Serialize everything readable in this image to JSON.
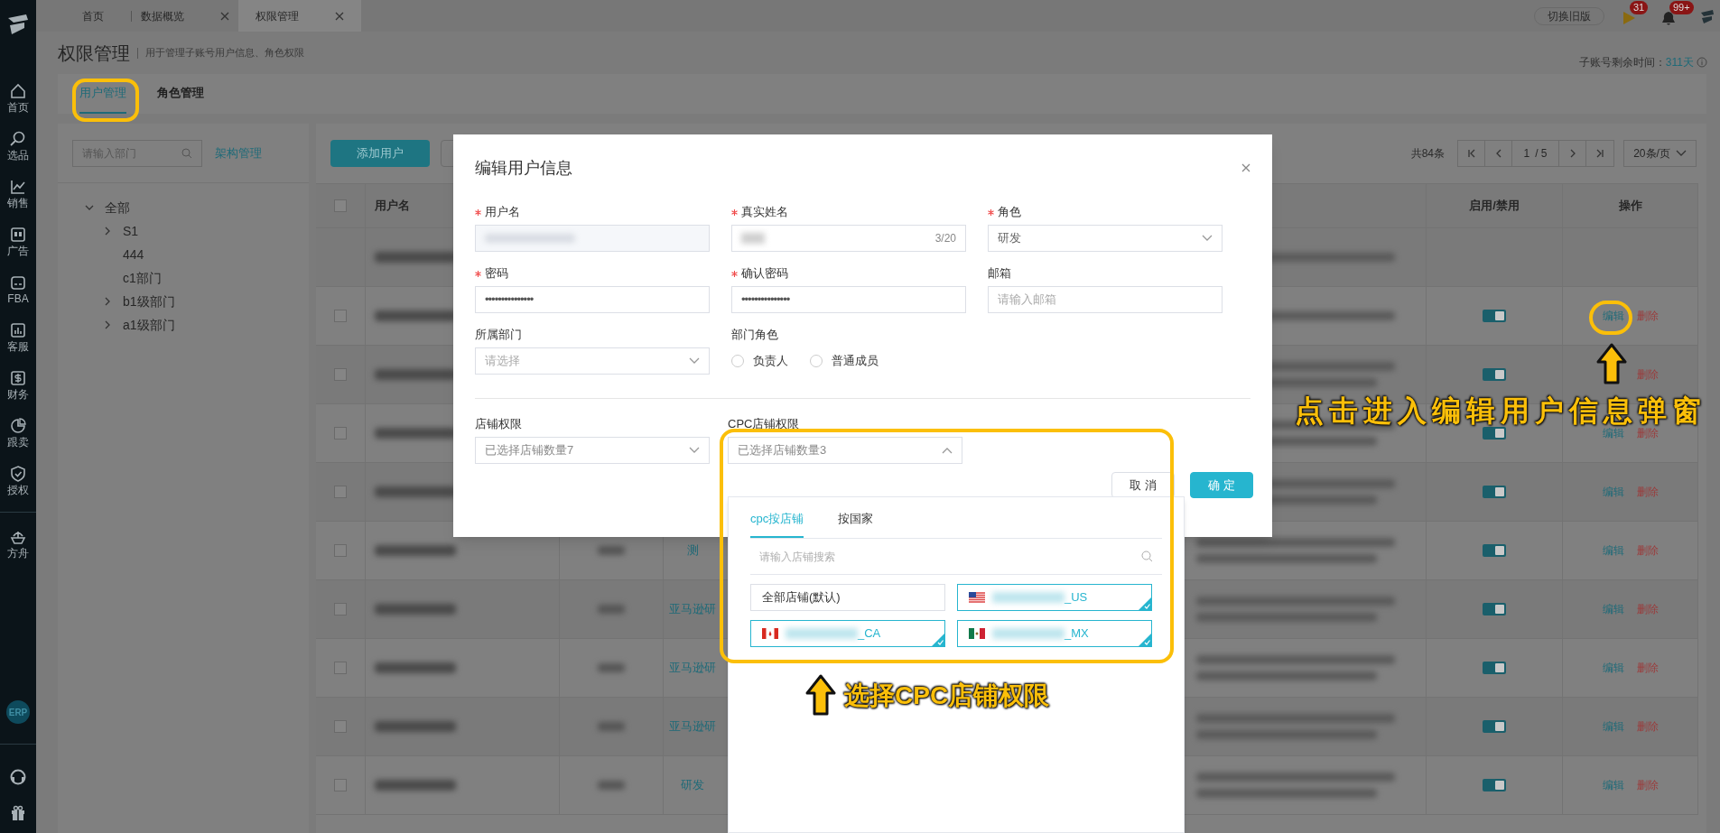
{
  "top_tabs": [
    {
      "label": "首页",
      "selected": false,
      "closable": false
    },
    {
      "label": "数据概览",
      "selected": false,
      "closable": true
    },
    {
      "label": "权限管理",
      "selected": true,
      "closable": true
    }
  ],
  "header": {
    "switch_button": "切换旧版",
    "flag_badge": "31",
    "bell_badge": "99+"
  },
  "sidebar": {
    "items": [
      {
        "label": "首页"
      },
      {
        "label": "选品"
      },
      {
        "label": "销售"
      },
      {
        "label": "广告"
      },
      {
        "label": "FBA"
      },
      {
        "label": "客服"
      },
      {
        "label": "财务"
      },
      {
        "label": "跟卖"
      },
      {
        "label": "授权"
      },
      {
        "label": "方舟"
      }
    ],
    "erp_badge": "ERP"
  },
  "page": {
    "title": "权限管理",
    "subtitle": "用于管理子账号用户信息、角色权限",
    "remaining_label": "子账号剩余时间：",
    "remaining_value": "311天"
  },
  "tabs": [
    {
      "label": "用户管理",
      "selected": true
    },
    {
      "label": "角色管理",
      "selected": false
    }
  ],
  "department_panel": {
    "search_placeholder": "请输入部门",
    "manage_link": "架构管理",
    "tree": [
      {
        "label": "全部",
        "expanded": true,
        "children": [
          {
            "label": "S1",
            "expanded": false,
            "kind": "folder"
          },
          {
            "label": "444",
            "kind": "leaf"
          },
          {
            "label": "c1部门",
            "kind": "leaf"
          },
          {
            "label": "b1级部门",
            "expanded": false,
            "kind": "folder"
          },
          {
            "label": "a1级部门",
            "expanded": false,
            "kind": "folder"
          }
        ]
      }
    ]
  },
  "toolbar": {
    "add_button": "添加用户"
  },
  "pagination": {
    "total": "共84条",
    "page": "1",
    "pages": "/ 5",
    "page_size": "20条/页"
  },
  "table": {
    "all_checked": false,
    "columns": [
      {
        "label": "用户名"
      },
      {
        "label": "启用/禁用"
      },
      {
        "label": "操作"
      }
    ],
    "rows": [
      {
        "kind": "main"
      },
      {
        "kind": "sub",
        "checked": false,
        "enabled": true,
        "edit": "编辑",
        "delete": "删除"
      },
      {
        "kind": "sub",
        "checked": false,
        "enabled": true,
        "delete": "删除"
      },
      {
        "kind": "sub",
        "checked": false,
        "enabled": true,
        "edit": "编辑",
        "delete": "删除"
      },
      {
        "kind": "sub",
        "checked": false,
        "enabled": true,
        "edit": "编辑",
        "delete": "删除"
      },
      {
        "kind": "sub",
        "checked": false,
        "enabled": true,
        "role": "测",
        "edit": "编辑",
        "delete": "删除"
      },
      {
        "kind": "sub",
        "checked": false,
        "enabled": true,
        "role": "亚马逊研",
        "edit": "编辑",
        "delete": "删除"
      },
      {
        "kind": "sub",
        "checked": false,
        "enabled": true,
        "role": "亚马逊研",
        "edit": "编辑",
        "delete": "删除"
      },
      {
        "kind": "sub",
        "checked": false,
        "enabled": true,
        "role": "亚马逊研",
        "edit": "编辑",
        "delete": "删除"
      },
      {
        "kind": "sub",
        "checked": false,
        "enabled": true,
        "role": "研发",
        "edit": "编辑",
        "delete": "删除"
      }
    ]
  },
  "dialog": {
    "title": "编辑用户信息",
    "fields": [
      {
        "label": "用户名",
        "required": true,
        "kind": "readonly"
      },
      {
        "label": "真实姓名",
        "required": true,
        "kind": "text",
        "counter": "3/20"
      },
      {
        "label": "角色",
        "required": true,
        "kind": "select",
        "value": "研发"
      },
      {
        "label": "密码",
        "required": true,
        "kind": "password",
        "value": "•••••••••••••••"
      },
      {
        "label": "确认密码",
        "required": true,
        "kind": "password",
        "value": "•••••••••••••••"
      },
      {
        "label": "邮箱",
        "required": false,
        "kind": "text",
        "placeholder": "请输入邮箱"
      },
      {
        "label": "所属部门",
        "required": false,
        "kind": "select",
        "placeholder": "请选择"
      },
      {
        "label": "部门角色",
        "required": false,
        "kind": "radio",
        "options": [
          {
            "label": "负责人",
            "selected": false
          },
          {
            "label": "普通成员",
            "selected": false
          }
        ]
      }
    ],
    "shop_fields": [
      {
        "label": "店铺权限",
        "value": "已选择店铺数量7",
        "expanded": false
      },
      {
        "label": "CPC店铺权限",
        "value": "已选择店铺数量3",
        "expanded": true
      }
    ],
    "buttons": [
      {
        "label": "取 消",
        "kind": "secondary"
      },
      {
        "label": "确 定",
        "kind": "primary"
      }
    ]
  },
  "cpc_dropdown": {
    "tabs": [
      {
        "label": "cpc按店铺",
        "selected": true
      },
      {
        "label": "按国家",
        "selected": false
      }
    ],
    "search_placeholder": "请输入店铺搜索",
    "stores": [
      {
        "label": "全部店铺(默认)",
        "selected": false
      },
      {
        "label": "_US",
        "selected": true
      },
      {
        "label": "_CA",
        "selected": true
      },
      {
        "label": "_MX",
        "selected": true
      }
    ]
  },
  "annotations": [
    {
      "text": "点击进入编辑用户信息弹窗"
    },
    {
      "text": "选择CPC店铺权限"
    }
  ]
}
